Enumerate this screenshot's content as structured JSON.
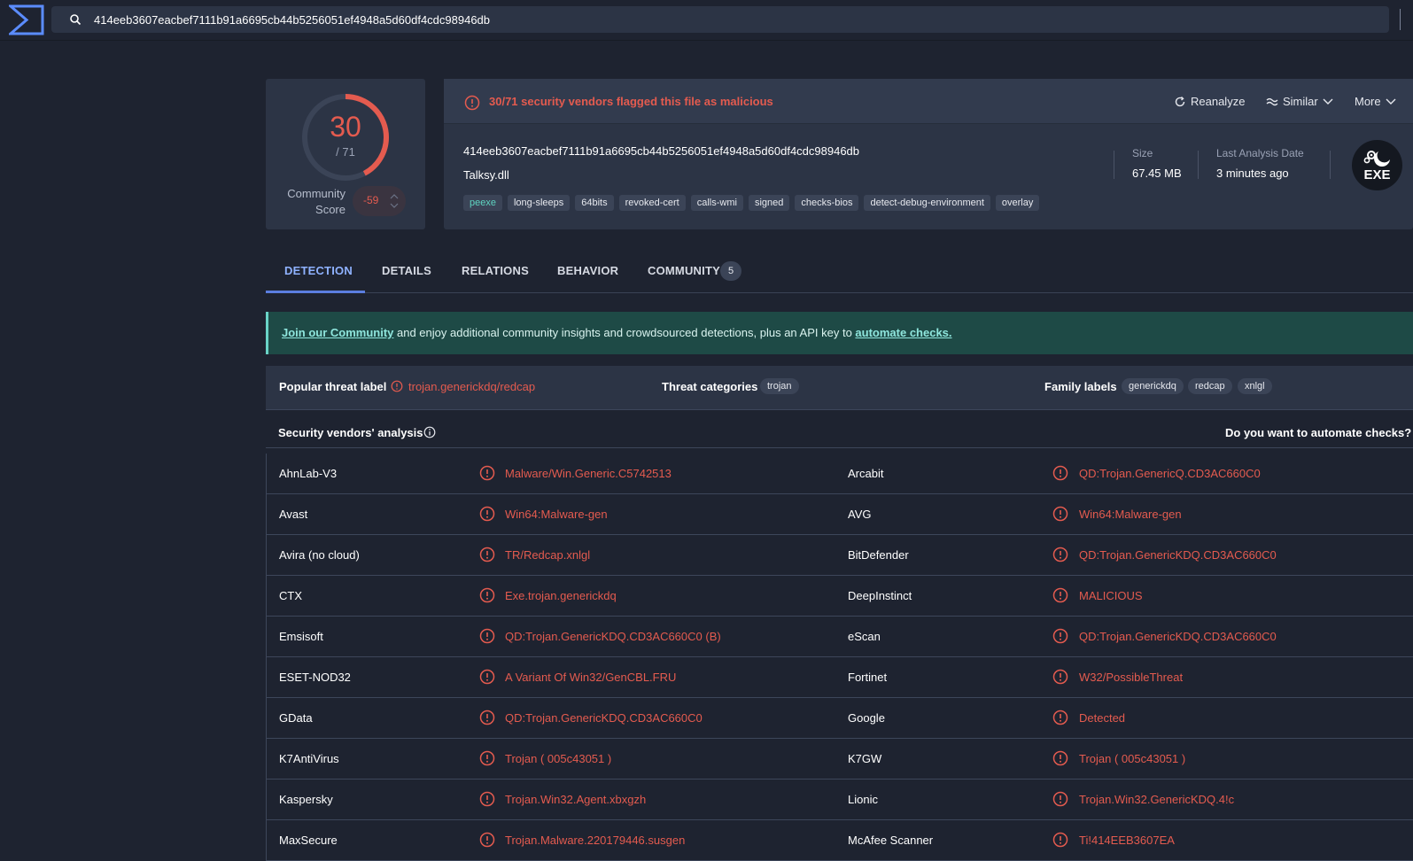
{
  "search": {
    "value": "414eeb3607eacbef7111b91a6695cb44b5256051ef4948a5d60df4cdc98946db"
  },
  "score": {
    "detections": "30",
    "total": "/ 71",
    "detection_fraction": 0.4225,
    "community_label_line1": "Community",
    "community_label_line2": "Score",
    "community_value": "-59"
  },
  "alert": {
    "text": "30/71 security vendors flagged this file as malicious"
  },
  "actions": {
    "reanalyze": "Reanalyze",
    "similar": "Similar",
    "more": "More"
  },
  "file": {
    "hash": "414eeb3607eacbef7111b91a6695cb44b5256051ef4948a5d60df4cdc98946db",
    "name": "Talksy.dll",
    "tags": [
      "peexe",
      "long-sleeps",
      "64bits",
      "revoked-cert",
      "calls-wmi",
      "signed",
      "checks-bios",
      "detect-debug-environment",
      "overlay"
    ],
    "size_label": "Size",
    "size_value": "67.45 MB",
    "date_label": "Last Analysis Date",
    "date_value": "3 minutes ago",
    "type_badge": "EXE"
  },
  "tabs": [
    {
      "label": "DETECTION"
    },
    {
      "label": "DETAILS"
    },
    {
      "label": "RELATIONS"
    },
    {
      "label": "BEHAVIOR"
    },
    {
      "label": "COMMUNITY"
    }
  ],
  "community_badge": "5",
  "banner": {
    "link1": "Join our Community",
    "middle": " and enjoy additional community insights and crowdsourced detections, plus an API key to ",
    "link2": "automate checks."
  },
  "threat": {
    "popular_label_title": "Popular threat label",
    "popular_label_value": "trojan.generickdq/redcap",
    "categories_title": "Threat categories",
    "categories": [
      "trojan"
    ],
    "family_title": "Family labels",
    "families": [
      "generickdq",
      "redcap",
      "xnlgl"
    ]
  },
  "vendors_header": {
    "title": "Security vendors' analysis",
    "automate": "Do you want to automate checks?"
  },
  "vendors": [
    {
      "left_name": "AhnLab-V3",
      "left_result": "Malware/Win.Generic.C5742513",
      "right_name": "Arcabit",
      "right_result": "QD:Trojan.GenericQ.CD3AC660C0"
    },
    {
      "left_name": "Avast",
      "left_result": "Win64:Malware-gen",
      "right_name": "AVG",
      "right_result": "Win64:Malware-gen"
    },
    {
      "left_name": "Avira (no cloud)",
      "left_result": "TR/Redcap.xnlgl",
      "right_name": "BitDefender",
      "right_result": "QD:Trojan.GenericKDQ.CD3AC660C0"
    },
    {
      "left_name": "CTX",
      "left_result": "Exe.trojan.generickdq",
      "right_name": "DeepInstinct",
      "right_result": "MALICIOUS"
    },
    {
      "left_name": "Emsisoft",
      "left_result": "QD:Trojan.GenericKDQ.CD3AC660C0 (B)",
      "right_name": "eScan",
      "right_result": "QD:Trojan.GenericKDQ.CD3AC660C0"
    },
    {
      "left_name": "ESET-NOD32",
      "left_result": "A Variant Of Win32/GenCBL.FRU",
      "right_name": "Fortinet",
      "right_result": "W32/PossibleThreat"
    },
    {
      "left_name": "GData",
      "left_result": "QD:Trojan.GenericKDQ.CD3AC660C0",
      "right_name": "Google",
      "right_result": "Detected"
    },
    {
      "left_name": "K7AntiVirus",
      "left_result": "Trojan ( 005c43051 )",
      "right_name": "K7GW",
      "right_result": "Trojan ( 005c43051 )"
    },
    {
      "left_name": "Kaspersky",
      "left_result": "Trojan.Win32.Agent.xbxgzh",
      "right_name": "Lionic",
      "right_result": "Trojan.Win32.GenericKDQ.4!c"
    },
    {
      "left_name": "MaxSecure",
      "left_result": "Trojan.Malware.220179446.susgen",
      "right_name": "McAfee Scanner",
      "right_result": "Ti!414EEB3607EA"
    }
  ],
  "colors": {
    "malicious": "#e45b4f",
    "accent": "#5b7ee0",
    "panel": "#2c3445",
    "background": "#1e2330"
  }
}
